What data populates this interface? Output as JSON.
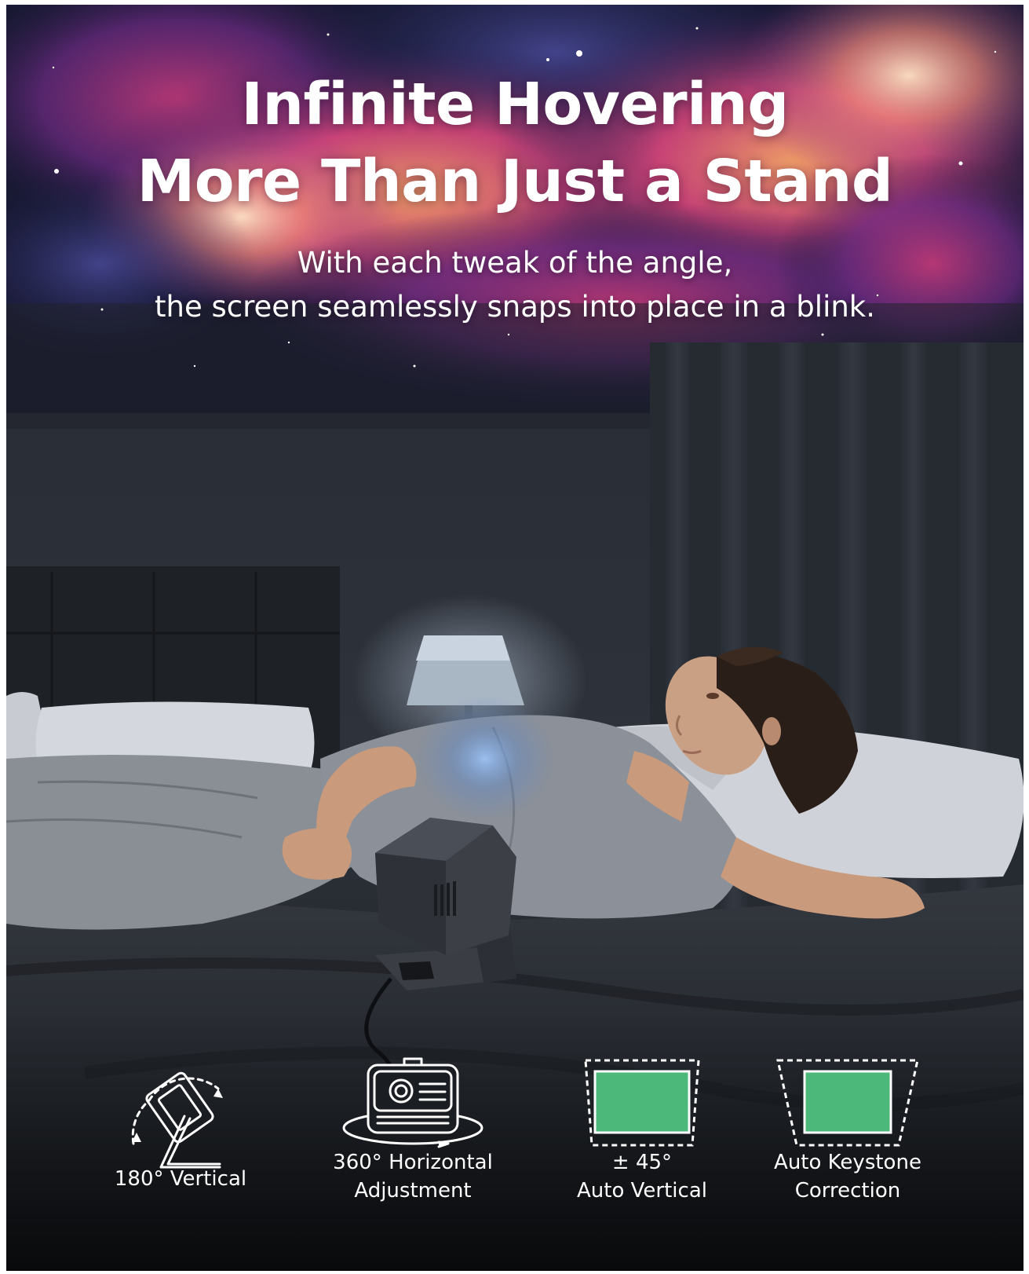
{
  "banner": {
    "headline_line1": "Infinite Hovering",
    "headline_line2": "More Than Just a Stand",
    "subhead_line1": "With each tweak of the angle,",
    "subhead_line2": "the screen seamlessly snaps into place in a blink."
  },
  "scene": {
    "description_icon": "bedroom-projector-scene"
  },
  "features": [
    {
      "icon": "rotate-vertical-icon",
      "line1": "180° Vertical",
      "line2": ""
    },
    {
      "icon": "projector-rotate-icon",
      "line1": "360° Horizontal",
      "line2": "Adjustment"
    },
    {
      "icon": "vertical-keystone-icon",
      "line1": "± 45°",
      "line2": "Auto Vertical"
    },
    {
      "icon": "auto-keystone-icon",
      "line1": "Auto Keystone",
      "line2": "Correction"
    }
  ],
  "colors": {
    "text": "#ffffff",
    "screen_green": "#4cb87a",
    "nebula_pink": "#e84a8a",
    "nebula_orange": "#f08a4a",
    "nebula_purple": "#5a3a8a",
    "wall": "#2a2f37",
    "bed": "#24282e"
  }
}
